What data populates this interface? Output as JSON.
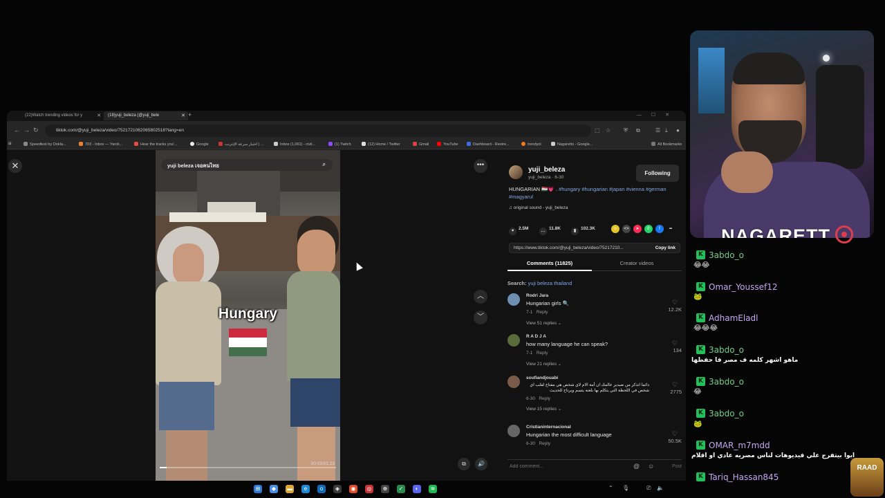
{
  "browser": {
    "tabs": [
      {
        "label": "(22)Watch trending videos for y"
      },
      {
        "label": "(18)yuji_beleza (@yuji_bele"
      }
    ],
    "url": "tiktok.com/@yuji_beleza/video/7521721062065802518?lang=en",
    "bookmarks": [
      "Speedtest by Ookla...",
      "703 - Inbox — Yaroli...",
      "Hear the tracks you'...",
      "Google",
      "اختبار سرعة الإنترنت | ...",
      "Inbox (1,061) - civil...",
      "(1) Twitch",
      "(12) Home / Twitter",
      "Gmail",
      "YouTube",
      "Dashboard - Restre...",
      "trendyol",
      "Nagaretto - Google...",
      "All Bookmarks"
    ]
  },
  "video": {
    "search_text": "yuji beleza เจอคนไทย",
    "caption": "Hungary",
    "timecode": "00:03/01:23",
    "progress_fraction": 0.04
  },
  "post": {
    "username": "yuji_beleza",
    "handle_date": "yuji_beleza · 6-30",
    "follow_label": "Following",
    "description_prefix": "HUNGARIAN 🇭🇺💗 .",
    "description_tags": "#hungary #hungarian #japan #vienna #german #magyarul",
    "sound": "♫ original sound - yuji_beleza",
    "likes": "2.5M",
    "comments_count": "11.8K",
    "saves": "102.3K",
    "link": "https://www.tiktok.com/@yuji_beleza/video/75217210...",
    "copy_link_label": "Copy link",
    "tab_comments": "Comments (11825)",
    "tab_creator": "Creator videos",
    "search_label": "Search:",
    "search_term": "yuji beleza thailand",
    "comments": [
      {
        "user": "Rodri Jara",
        "text": "Hungarian girls 🔍",
        "date": "7-1",
        "reply": "Reply",
        "replies": "View 51 replies",
        "likes": "12.2K",
        "color": "#6e8fb0"
      },
      {
        "user": "R A D J A",
        "text": "how many language he can speak?",
        "date": "7-1",
        "reply": "Reply",
        "replies": "View 21 replies",
        "likes": "134",
        "color": "#5a6a3a"
      },
      {
        "user": "soufiandjouabi",
        "text": "دائما اتذكر من ضيدير عالمك ان أمة الام لاي شخص هي مفتاح لقلب اي شخص في اللحظة التي يتكلم بها بلغته يتسم ويرتاح للحديث",
        "date": "6-30",
        "reply": "Reply",
        "replies": "View 15 replies",
        "likes": "2775",
        "color": "#7a5a4a"
      },
      {
        "user": "Cristianinternacional",
        "text": "Hungarian the most difficult language",
        "date": "6-30",
        "reply": "Reply",
        "replies": "",
        "likes": "50.5K",
        "color": "#666"
      }
    ],
    "add_comment_placeholder": "Add comment...",
    "post_label": "Post"
  },
  "stream": {
    "logo_text": "NAGARETT",
    "chat": [
      {
        "user": "3abdo_o",
        "color": "#6fd08c",
        "body": "😂😂",
        "type": "emote"
      },
      {
        "user": "Omar_Youssef12",
        "color": "#c4a6f2",
        "body": "🐸",
        "type": "emote"
      },
      {
        "user": "AdhamEladl",
        "color": "#c4a6f2",
        "body": "😂😂😂",
        "type": "emote"
      },
      {
        "user": "3abdo_o",
        "color": "#6fd08c",
        "body": "ماهو اشهر كلمه ف مصر فا حفظها",
        "type": "text"
      },
      {
        "user": "3abdo_o",
        "color": "#6fd08c",
        "body": "😂",
        "type": "emote"
      },
      {
        "user": "3abdo_o",
        "color": "#6fd08c",
        "body": "🐸",
        "type": "emote"
      },
      {
        "user": "OMAR_m7mdd",
        "color": "#c4a6f2",
        "body": "ايوا بيتفرج علي فيديوهات لناس مصريه عادي او افلام",
        "type": "text"
      },
      {
        "user": "Tariq_Hassan845",
        "color": "#c4a6f2",
        "body": "",
        "type": "none"
      }
    ],
    "watermark": "RAAD"
  }
}
